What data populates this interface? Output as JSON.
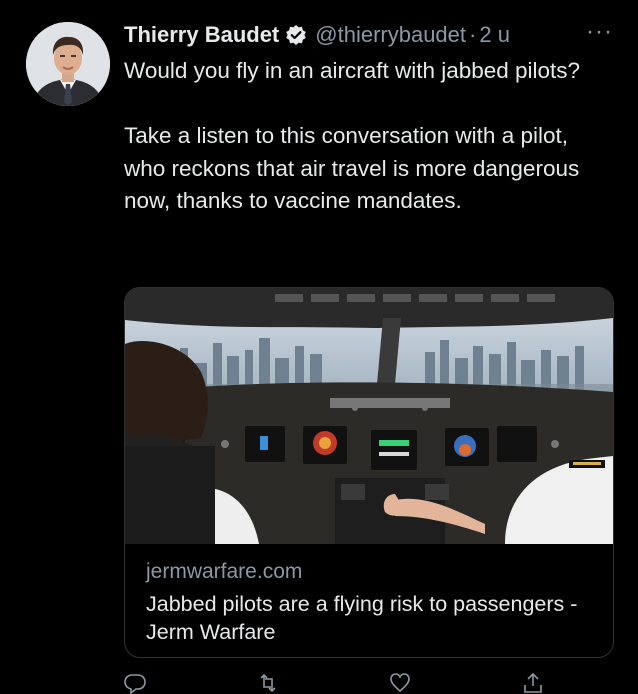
{
  "tweet": {
    "author_name": "Thierry Baudet",
    "handle": "@thierrybaudet",
    "separator": "·",
    "time": "2 u",
    "text_paragraphs": [
      "Would you fly in an aircraft with jabbed pilots?",
      "Take a listen to this conversation with a pilot, who reckons that air travel is more dangerous now, thanks to vaccine mandates."
    ],
    "more_icon": "more-dots-icon",
    "verified_icon": "verified-badge-icon"
  },
  "card": {
    "domain": "jermwarfare.com",
    "title": "Jabbed pilots are a flying risk to passengers - Jerm Warfare",
    "image": "cockpit-photo"
  },
  "actions": [
    "reply-icon",
    "retweet-icon",
    "like-icon",
    "share-icon"
  ],
  "colors": {
    "background": "#000000",
    "primary_text": "#e7e9ea",
    "secondary_text": "#8b98a5",
    "border": "#2f3336",
    "verified": "#1d9bf0"
  }
}
